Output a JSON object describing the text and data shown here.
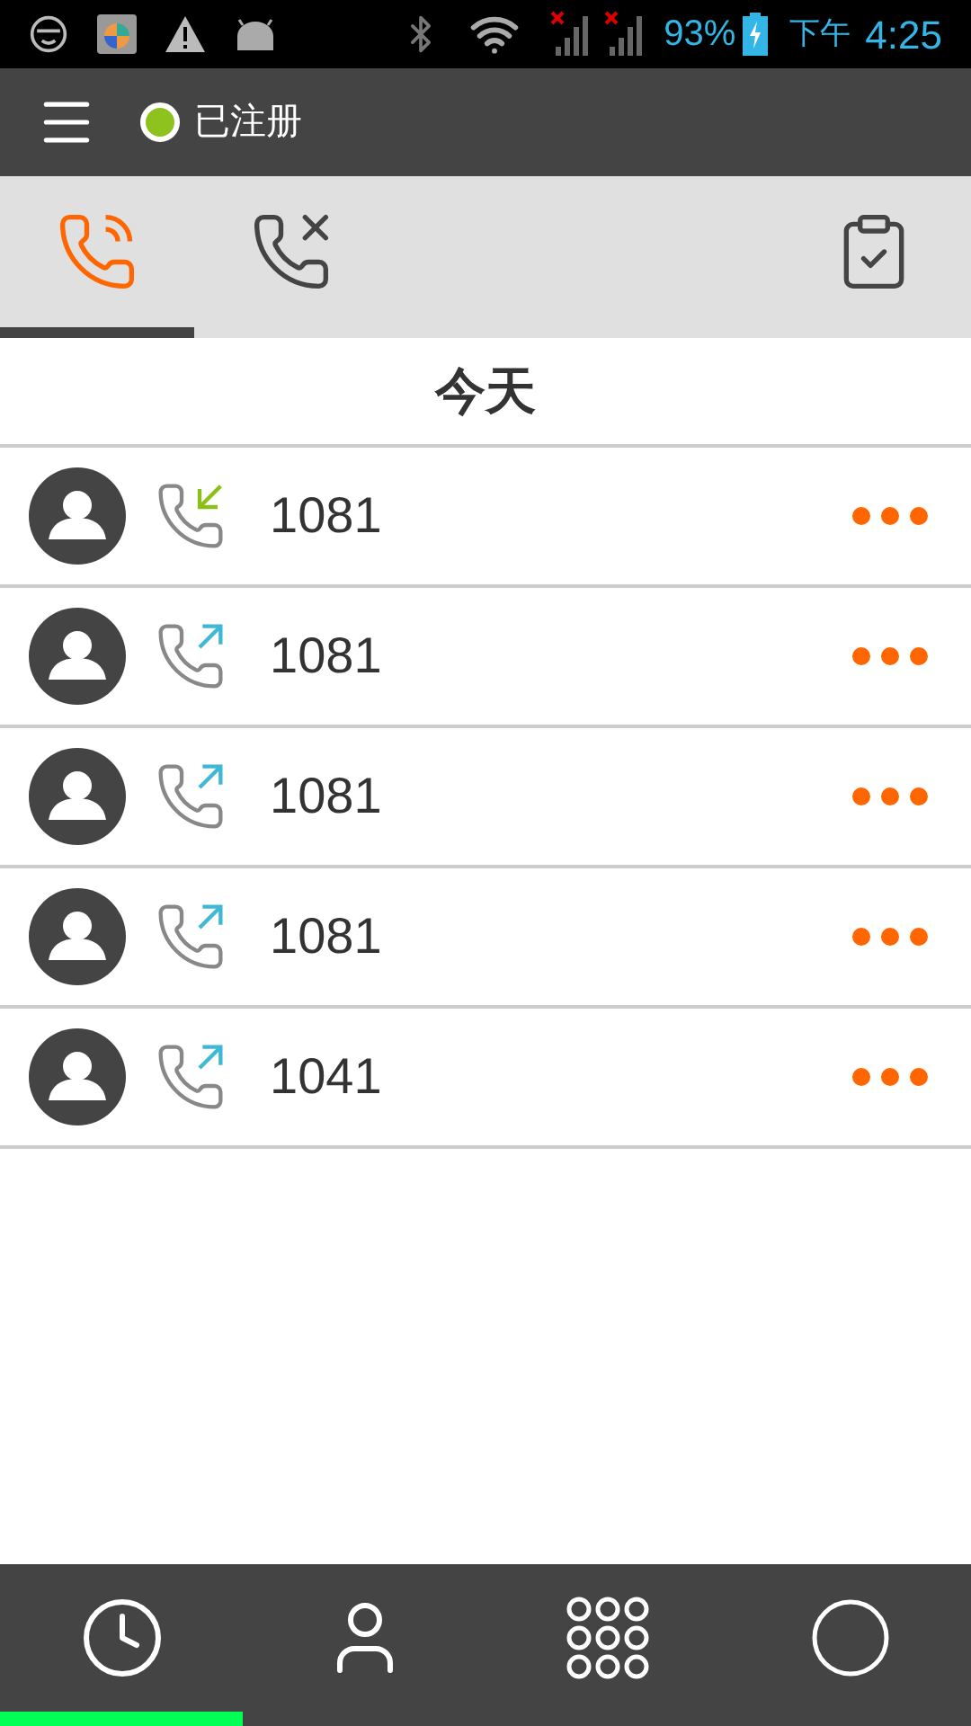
{
  "status_bar": {
    "battery": "93%",
    "period": "下午",
    "time": "4:25"
  },
  "header": {
    "status": "已注册",
    "registered": true
  },
  "tabs": [
    {
      "kind": "calls",
      "selected": true
    },
    {
      "kind": "missed",
      "selected": false
    },
    {
      "kind": "edit",
      "selected": false
    }
  ],
  "section_title": "今天",
  "calls": [
    {
      "number": "1081",
      "kind": "incoming"
    },
    {
      "number": "1081",
      "kind": "outgoing"
    },
    {
      "number": "1081",
      "kind": "outgoing"
    },
    {
      "number": "1081",
      "kind": "outgoing"
    },
    {
      "number": "1041",
      "kind": "outgoing"
    }
  ],
  "nav": [
    {
      "kind": "history",
      "selected": true
    },
    {
      "kind": "contacts",
      "selected": false
    },
    {
      "kind": "dialpad",
      "selected": false
    },
    {
      "kind": "other",
      "selected": false
    }
  ]
}
